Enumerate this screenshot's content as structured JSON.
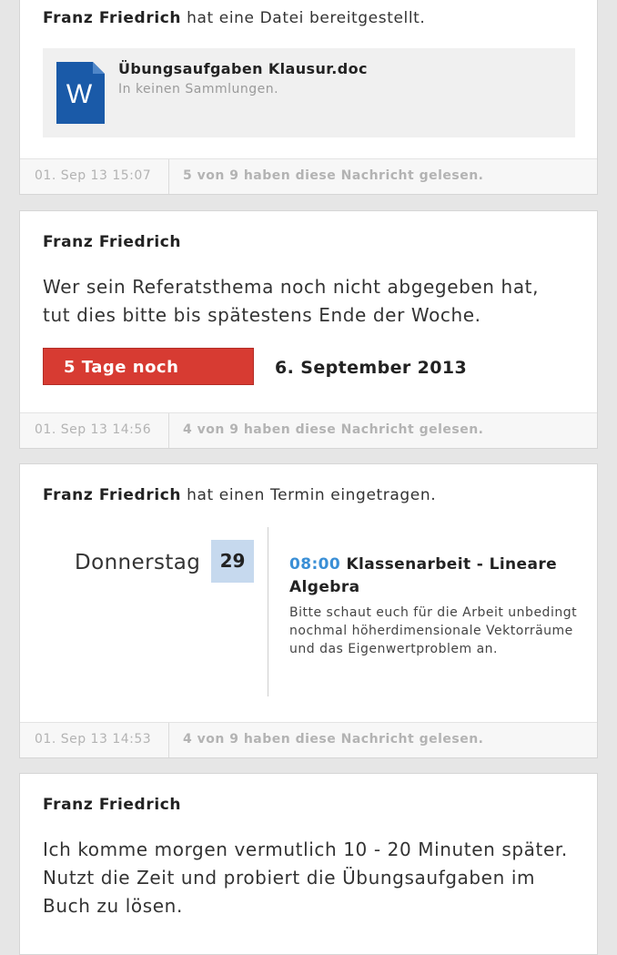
{
  "posts": [
    {
      "author": "Franz Friedrich",
      "action": " hat eine Datei bereitgestellt.",
      "file": {
        "name": "Übungsaufgaben Klausur.doc",
        "collections": "In keinen Sammlungen.",
        "icon": "word-document-icon",
        "icon_letter": "W",
        "icon_color": "#1a5aa8"
      },
      "timestamp": "01. Sep 13 15:07",
      "read_status": "5 von 9 haben diese Nachricht gelesen."
    },
    {
      "author": "Franz Friedrich",
      "message": "Wer sein Referatsthema noch nicht abgegeben hat, tut dies bitte bis spätestens Ende der Woche.",
      "deadline": {
        "remaining": "5 Tage noch",
        "date": "6. September 2013",
        "color": "#d73b32"
      },
      "timestamp": "01. Sep 13 14:56",
      "read_status": "4 von 9 haben diese Nachricht gelesen."
    },
    {
      "author": "Franz Friedrich",
      "action": " hat einen Termin eingetragen.",
      "appointment": {
        "weekday": "Donnerstag",
        "day": "29",
        "time": "08:00",
        "title": " Klassenarbeit - Lineare Algebra",
        "description": "Bitte schaut euch für die Arbeit unbedingt nochmal höherdimensionale Vektorräume und das Eigenwertproblem an.",
        "time_color": "#3a8fd6",
        "day_bg": "#c6d9ee"
      },
      "timestamp": "01. Sep 13 14:53",
      "read_status": "4 von 9 haben diese Nachricht gelesen."
    },
    {
      "author": "Franz Friedrich",
      "message": "Ich komme morgen vermutlich 10 - 20 Minuten später. Nutzt die Zeit und probiert die Übungsaufgaben im Buch zu lösen."
    }
  ]
}
